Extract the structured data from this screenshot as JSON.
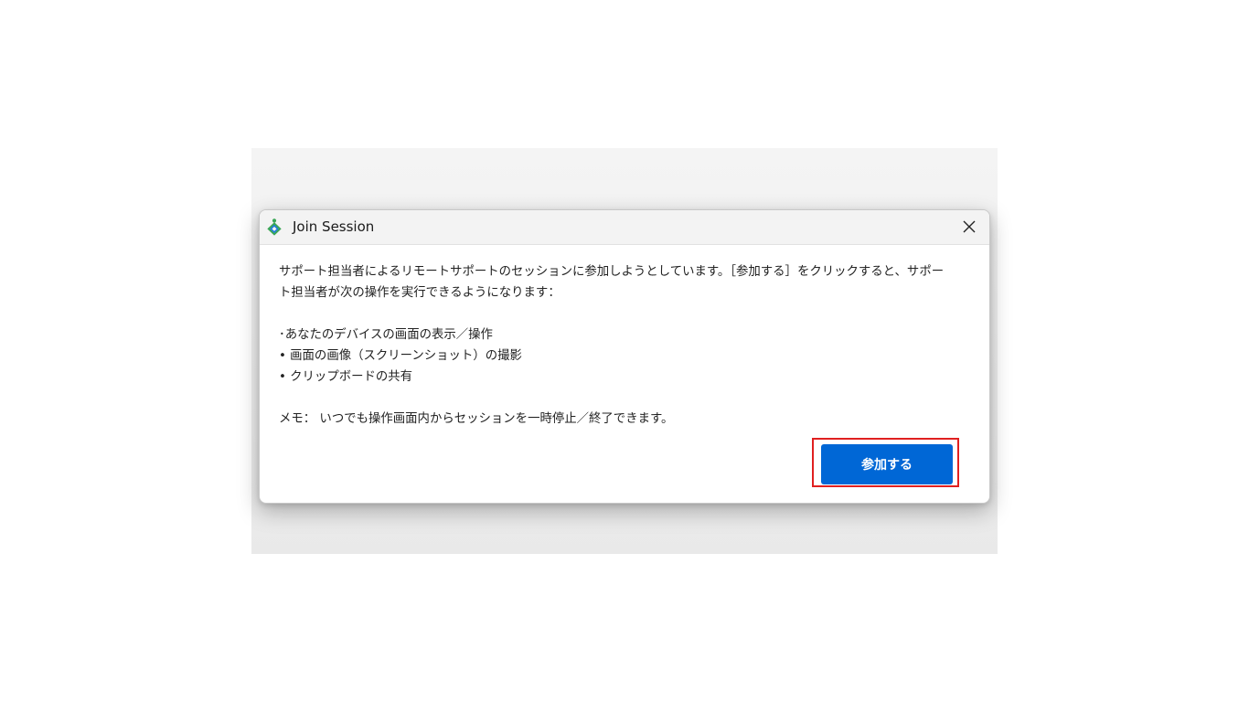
{
  "window": {
    "title": "Join Session",
    "icon": "join-session-app-icon",
    "close_icon": "close-icon"
  },
  "message": {
    "intro": "サポート担当者によるリモートサポートのセッションに参加しようとしています。［参加する］をクリックすると、サポート担当者が次の操作を実行できるようになります：",
    "items": [
      "･あなたのデバイスの画面の表示／操作",
      "• 画面の画像（スクリーンショット）の撮影",
      "• クリップボードの共有"
    ],
    "note": "メモ： いつでも操作画面内からセッションを一時停止／終了できます。"
  },
  "actions": {
    "join_label": "参加する"
  },
  "colors": {
    "accent": "#0067d6",
    "highlight": "#e02020",
    "icon_green": "#3aa655",
    "icon_blue": "#1f7bd8"
  }
}
